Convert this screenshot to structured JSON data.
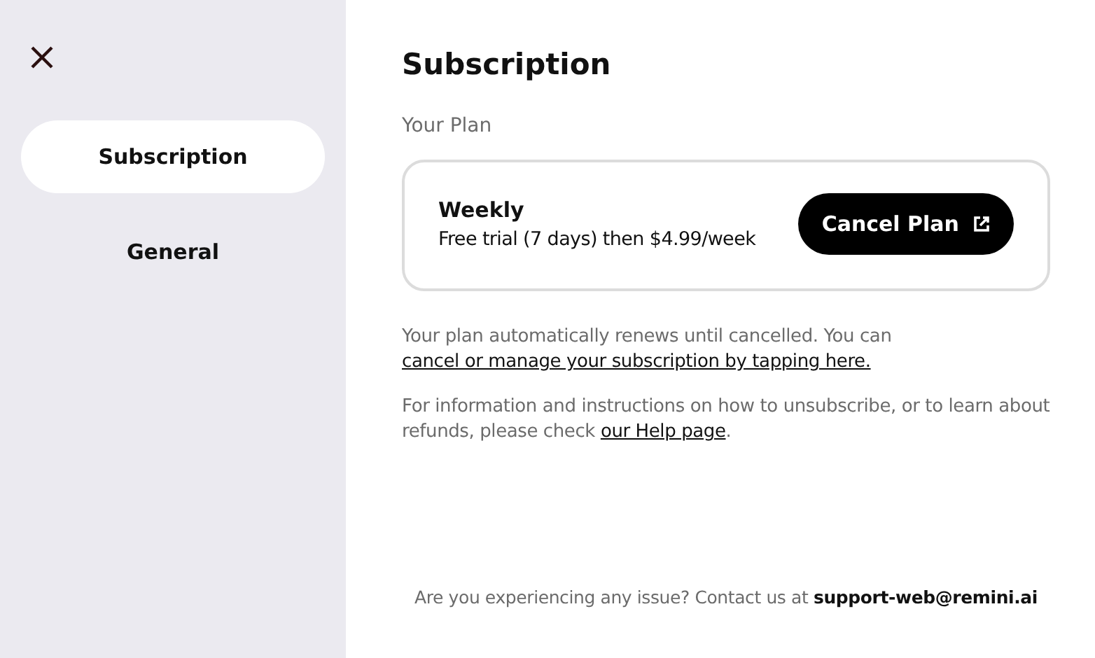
{
  "sidebar": {
    "items": [
      {
        "label": "Subscription",
        "selected": true
      },
      {
        "label": "General",
        "selected": false
      }
    ]
  },
  "main": {
    "title": "Subscription",
    "section_label": "Your Plan",
    "plan": {
      "name": "Weekly",
      "details": "Free trial (7 days) then $4.99/week",
      "button": "Cancel Plan"
    },
    "paragraphs": [
      {
        "before": "Your plan automatically renews until cancelled. You can ",
        "link": "cancel or manage your subscription by tapping here."
      },
      {
        "before": "For information and instructions on how to unsubscribe, or to learn about refunds, please check ",
        "link": "our Help page",
        "after": "."
      }
    ],
    "footer": {
      "text": "Are you experiencing any issue? Contact us at ",
      "email": "support-web@remini.ai"
    }
  }
}
